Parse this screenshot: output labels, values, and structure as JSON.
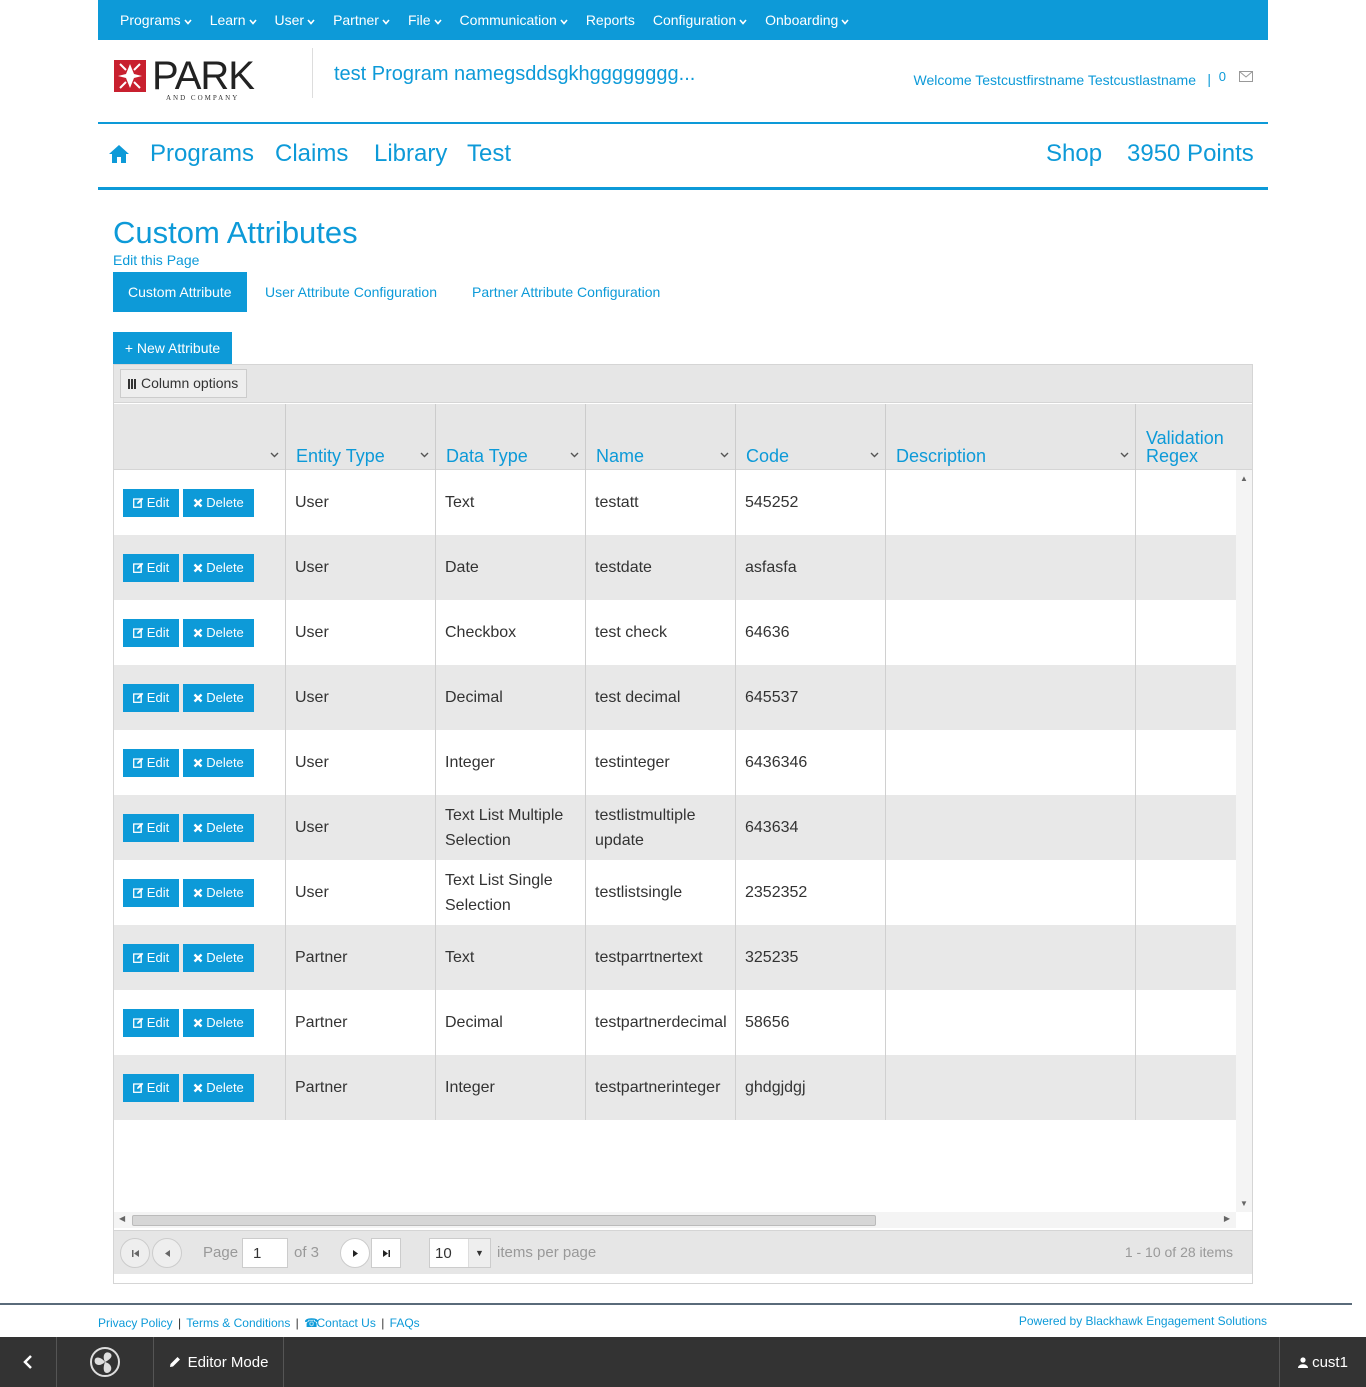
{
  "top_nav": {
    "items": [
      {
        "label": "Programs",
        "dropdown": true
      },
      {
        "label": "Learn",
        "dropdown": true
      },
      {
        "label": "User",
        "dropdown": true
      },
      {
        "label": "Partner",
        "dropdown": true
      },
      {
        "label": "File",
        "dropdown": true
      },
      {
        "label": "Communication",
        "dropdown": true
      },
      {
        "label": "Reports",
        "dropdown": false
      },
      {
        "label": "Configuration",
        "dropdown": true
      },
      {
        "label": "Onboarding",
        "dropdown": true
      }
    ]
  },
  "header": {
    "logo_text": "PARK",
    "logo_subtext": "AND COMPANY",
    "program_name": "test Program namegsddsgkhgggggggg...",
    "welcome": "Welcome Testcustfirstname Testcustlastname",
    "separator": "|",
    "message_count": "0"
  },
  "main_nav": {
    "programs": "Programs",
    "claims": "Claims",
    "library": "Library",
    "test": "Test",
    "shop": "Shop",
    "points": "3950 Points"
  },
  "page": {
    "title": "Custom Attributes",
    "edit_link": "Edit this Page"
  },
  "tabs": {
    "custom": "Custom Attribute",
    "user": "User Attribute Configuration",
    "partner": "Partner Attribute Configuration"
  },
  "new_attribute_label": "+ New Attribute",
  "grid": {
    "column_options_label": "Column options",
    "columns": [
      "Entity Type",
      "Data Type",
      "Name",
      "Code",
      "Description",
      "Validation Regex"
    ],
    "edit_label": "Edit",
    "delete_label": "Delete",
    "rows": [
      {
        "entity": "User",
        "data_type": "Text",
        "name": "testatt",
        "code": "545252",
        "description": "",
        "regex": ""
      },
      {
        "entity": "User",
        "data_type": "Date",
        "name": "testdate",
        "code": "asfasfa",
        "description": "",
        "regex": ""
      },
      {
        "entity": "User",
        "data_type": "Checkbox",
        "name": "test check",
        "code": "64636",
        "description": "",
        "regex": ""
      },
      {
        "entity": "User",
        "data_type": "Decimal",
        "name": "test decimal",
        "code": "645537",
        "description": "",
        "regex": ""
      },
      {
        "entity": "User",
        "data_type": "Integer",
        "name": "testinteger",
        "code": "6436346",
        "description": "",
        "regex": ""
      },
      {
        "entity": "User",
        "data_type": "Text List Multiple Selection",
        "name": "testlistmultiple update",
        "code": "643634",
        "description": "",
        "regex": ""
      },
      {
        "entity": "User",
        "data_type": "Text List Single Selection",
        "name": "testlistsingle",
        "code": "2352352",
        "description": "",
        "regex": ""
      },
      {
        "entity": "Partner",
        "data_type": "Text",
        "name": "testparrtnertext",
        "code": "325235",
        "description": "",
        "regex": ""
      },
      {
        "entity": "Partner",
        "data_type": "Decimal",
        "name": "testpartnerdecimal",
        "code": "58656",
        "description": "",
        "regex": ""
      },
      {
        "entity": "Partner",
        "data_type": "Integer",
        "name": "testpartnerinteger",
        "code": "ghdgjdgj",
        "description": "",
        "regex": ""
      }
    ]
  },
  "pager": {
    "page_label": "Page",
    "page_value": "1",
    "of_label": "of 3",
    "page_size": "10",
    "items_per_page": "items per page",
    "info": "1 - 10 of 28 items"
  },
  "footer": {
    "privacy": "Privacy Policy",
    "terms": "Terms & Conditions",
    "contact": "Contact Us",
    "faqs": "FAQs",
    "separator": "|",
    "powered": "Powered by Blackhawk Engagement Solutions"
  },
  "bottom_bar": {
    "editor_mode": "Editor Mode",
    "user": "cust1"
  },
  "colors": {
    "brand_blue": "#0d9ad8",
    "logo_red": "#c8202f",
    "bar_dark": "#333333"
  }
}
